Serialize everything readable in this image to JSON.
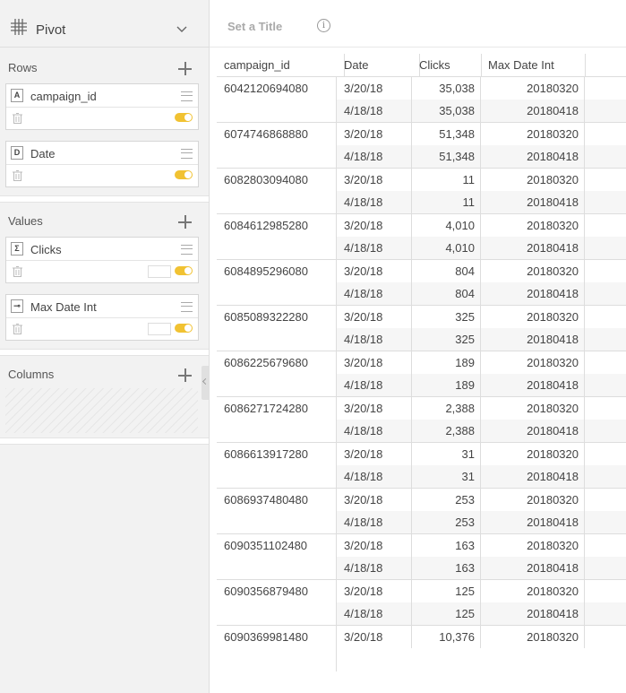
{
  "widget_type": {
    "label": "Pivot",
    "icon": "grid-icon"
  },
  "sidebar": {
    "rows_title": "Rows",
    "values_title": "Values",
    "columns_title": "Columns",
    "rows": [
      {
        "badge": "A",
        "label": "campaign_id"
      },
      {
        "badge": "D",
        "label": "Date"
      }
    ],
    "values": [
      {
        "badge": "Σ",
        "label": "Clicks"
      },
      {
        "badge": "⊸",
        "label": "Max Date Int"
      }
    ]
  },
  "title_bar": {
    "placeholder": "Set a Title",
    "info_icon": "i"
  },
  "table": {
    "columns": [
      "campaign_id",
      "Date",
      "Clicks",
      "Max Date Int"
    ],
    "groups": [
      {
        "id": "6042120694080",
        "rows": [
          [
            "3/20/18",
            "35,038",
            "20180320"
          ],
          [
            "4/18/18",
            "35,038",
            "20180418"
          ]
        ]
      },
      {
        "id": "6074746868880",
        "rows": [
          [
            "3/20/18",
            "51,348",
            "20180320"
          ],
          [
            "4/18/18",
            "51,348",
            "20180418"
          ]
        ]
      },
      {
        "id": "6082803094080",
        "rows": [
          [
            "3/20/18",
            "11",
            "20180320"
          ],
          [
            "4/18/18",
            "11",
            "20180418"
          ]
        ]
      },
      {
        "id": "6084612985280",
        "rows": [
          [
            "3/20/18",
            "4,010",
            "20180320"
          ],
          [
            "4/18/18",
            "4,010",
            "20180418"
          ]
        ]
      },
      {
        "id": "6084895296080",
        "rows": [
          [
            "3/20/18",
            "804",
            "20180320"
          ],
          [
            "4/18/18",
            "804",
            "20180418"
          ]
        ]
      },
      {
        "id": "6085089322280",
        "rows": [
          [
            "3/20/18",
            "325",
            "20180320"
          ],
          [
            "4/18/18",
            "325",
            "20180418"
          ]
        ]
      },
      {
        "id": "6086225679680",
        "rows": [
          [
            "3/20/18",
            "189",
            "20180320"
          ],
          [
            "4/18/18",
            "189",
            "20180418"
          ]
        ]
      },
      {
        "id": "6086271724280",
        "rows": [
          [
            "3/20/18",
            "2,388",
            "20180320"
          ],
          [
            "4/18/18",
            "2,388",
            "20180418"
          ]
        ]
      },
      {
        "id": "6086613917280",
        "rows": [
          [
            "3/20/18",
            "31",
            "20180320"
          ],
          [
            "4/18/18",
            "31",
            "20180418"
          ]
        ]
      },
      {
        "id": "6086937480480",
        "rows": [
          [
            "3/20/18",
            "253",
            "20180320"
          ],
          [
            "4/18/18",
            "253",
            "20180418"
          ]
        ]
      },
      {
        "id": "6090351102480",
        "rows": [
          [
            "3/20/18",
            "163",
            "20180320"
          ],
          [
            "4/18/18",
            "163",
            "20180418"
          ]
        ]
      },
      {
        "id": "6090356879480",
        "rows": [
          [
            "3/20/18",
            "125",
            "20180320"
          ],
          [
            "4/18/18",
            "125",
            "20180418"
          ]
        ]
      },
      {
        "id": "6090369981480",
        "rows": [
          [
            "3/20/18",
            "10,376",
            "20180320"
          ]
        ]
      }
    ]
  }
}
